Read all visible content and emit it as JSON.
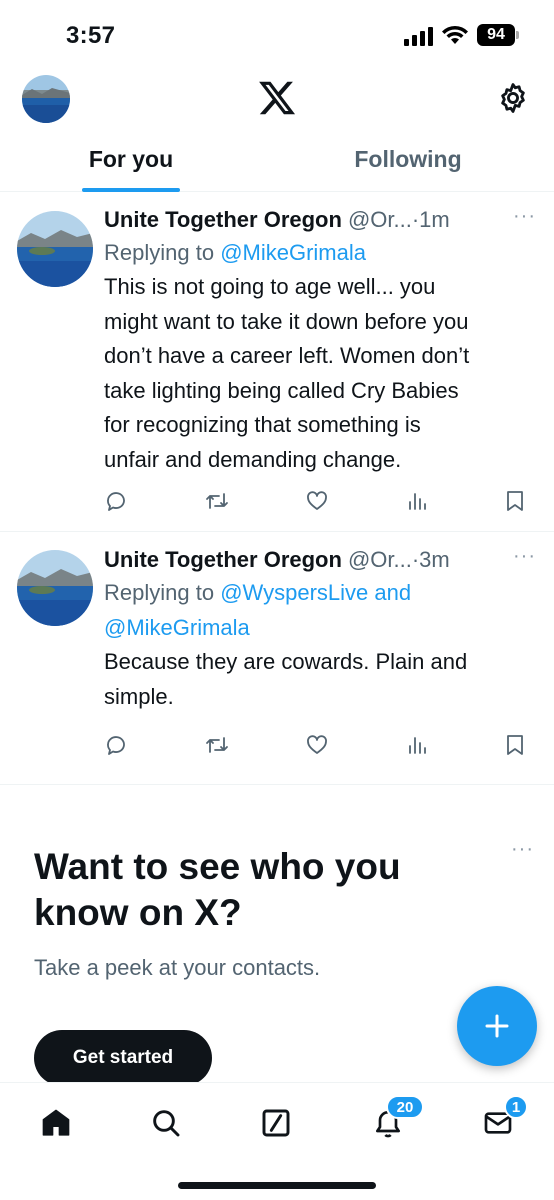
{
  "status_bar": {
    "time": "3:57",
    "battery": "94"
  },
  "header": {
    "tabs": [
      {
        "label": "For you",
        "active": true
      },
      {
        "label": "Following",
        "active": false
      }
    ]
  },
  "tweets": [
    {
      "name": "Unite Together Oregon",
      "handle": "@Or...",
      "separator": "·",
      "time": "1m",
      "more": "···",
      "reply_prefix": "Replying to ",
      "reply_mentions": "@MikeGrimala",
      "text_lines": [
        "This is not going to age well... you",
        "might want to take it down before you",
        "don’t have a career left. Women don’t",
        "take lighting being called Cry Babies",
        "for recognizing that something is",
        "unfair and demanding change."
      ]
    },
    {
      "name": "Unite Together Oregon",
      "handle": "@Or...",
      "separator": "·",
      "time": "3m",
      "more": "···",
      "reply_prefix": "Replying to ",
      "reply_mentions": "@WyspersLive and",
      "reply_mentions_2": "@MikeGrimala",
      "text_lines": [
        "Because they are cowards. Plain and",
        "simple."
      ]
    }
  ],
  "promo": {
    "title": "Want to see who you know on X?",
    "subtitle": "Take a peek at your contacts.",
    "button_label": "Get started",
    "more": "···"
  },
  "bottom_nav": {
    "notifications_badge": "20",
    "messages_badge": "1"
  },
  "colors": {
    "accent": "#1d9bf0",
    "text": "#0f1419",
    "secondary": "#536471"
  },
  "icons": [
    "home-icon",
    "search-icon",
    "grok-icon",
    "bell-icon",
    "mail-icon",
    "x-logo-icon",
    "gear-icon",
    "reply-icon",
    "retweet-icon",
    "like-icon",
    "views-icon",
    "bookmark-icon",
    "plus-icon"
  ]
}
